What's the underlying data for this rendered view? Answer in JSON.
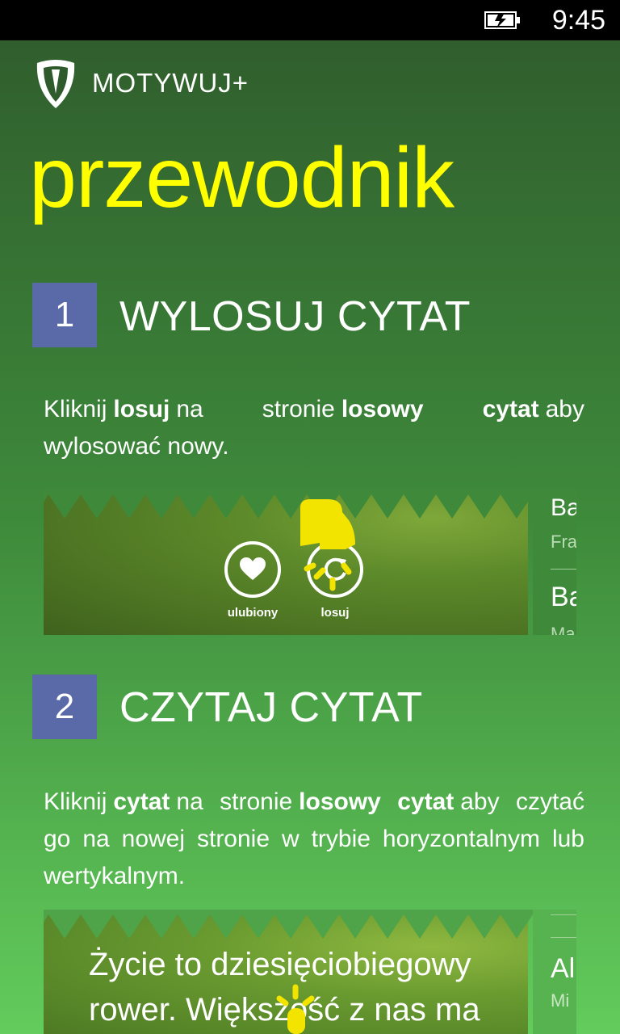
{
  "statusbar": {
    "time": "9:45",
    "battery_icon": "battery-charging-icon"
  },
  "header": {
    "app_title": "MOTYWUJ+",
    "logo_icon": "shield-logo-icon"
  },
  "page": {
    "title": "przewodnik"
  },
  "colors": {
    "title": "#ffff00",
    "badge": "#5a6aa8"
  },
  "steps": [
    {
      "number": "1",
      "title": "WYLOSUJ CYTAT",
      "text": {
        "t1": "Kliknij",
        "b1": "losuj",
        "t2": "na stronie",
        "b2": "losowy cytat",
        "t3": "aby wylosować nowy."
      },
      "screenshot": {
        "buttons": [
          {
            "label": "ulubiony",
            "icon": "heart-icon"
          },
          {
            "label": "losuj",
            "icon": "refresh-icon"
          }
        ],
        "side_items": [
          "Ba",
          "Fra",
          "Ba",
          "Ma"
        ]
      }
    },
    {
      "number": "2",
      "title": "CZYTAJ CYTAT",
      "text": {
        "t1": "Kliknij",
        "b1": "cytat",
        "t2": "na stronie",
        "b2": "losowy cytat",
        "t3": "aby czytać go na nowej stronie w trybie horyzontalnym lub wertykalnym."
      },
      "screenshot": {
        "quote_line1": "Życie to dziesięciobiegowy",
        "quote_line2": "rower. Większość z nas ma",
        "side_items": [
          "Al",
          "Mi"
        ]
      }
    }
  ]
}
